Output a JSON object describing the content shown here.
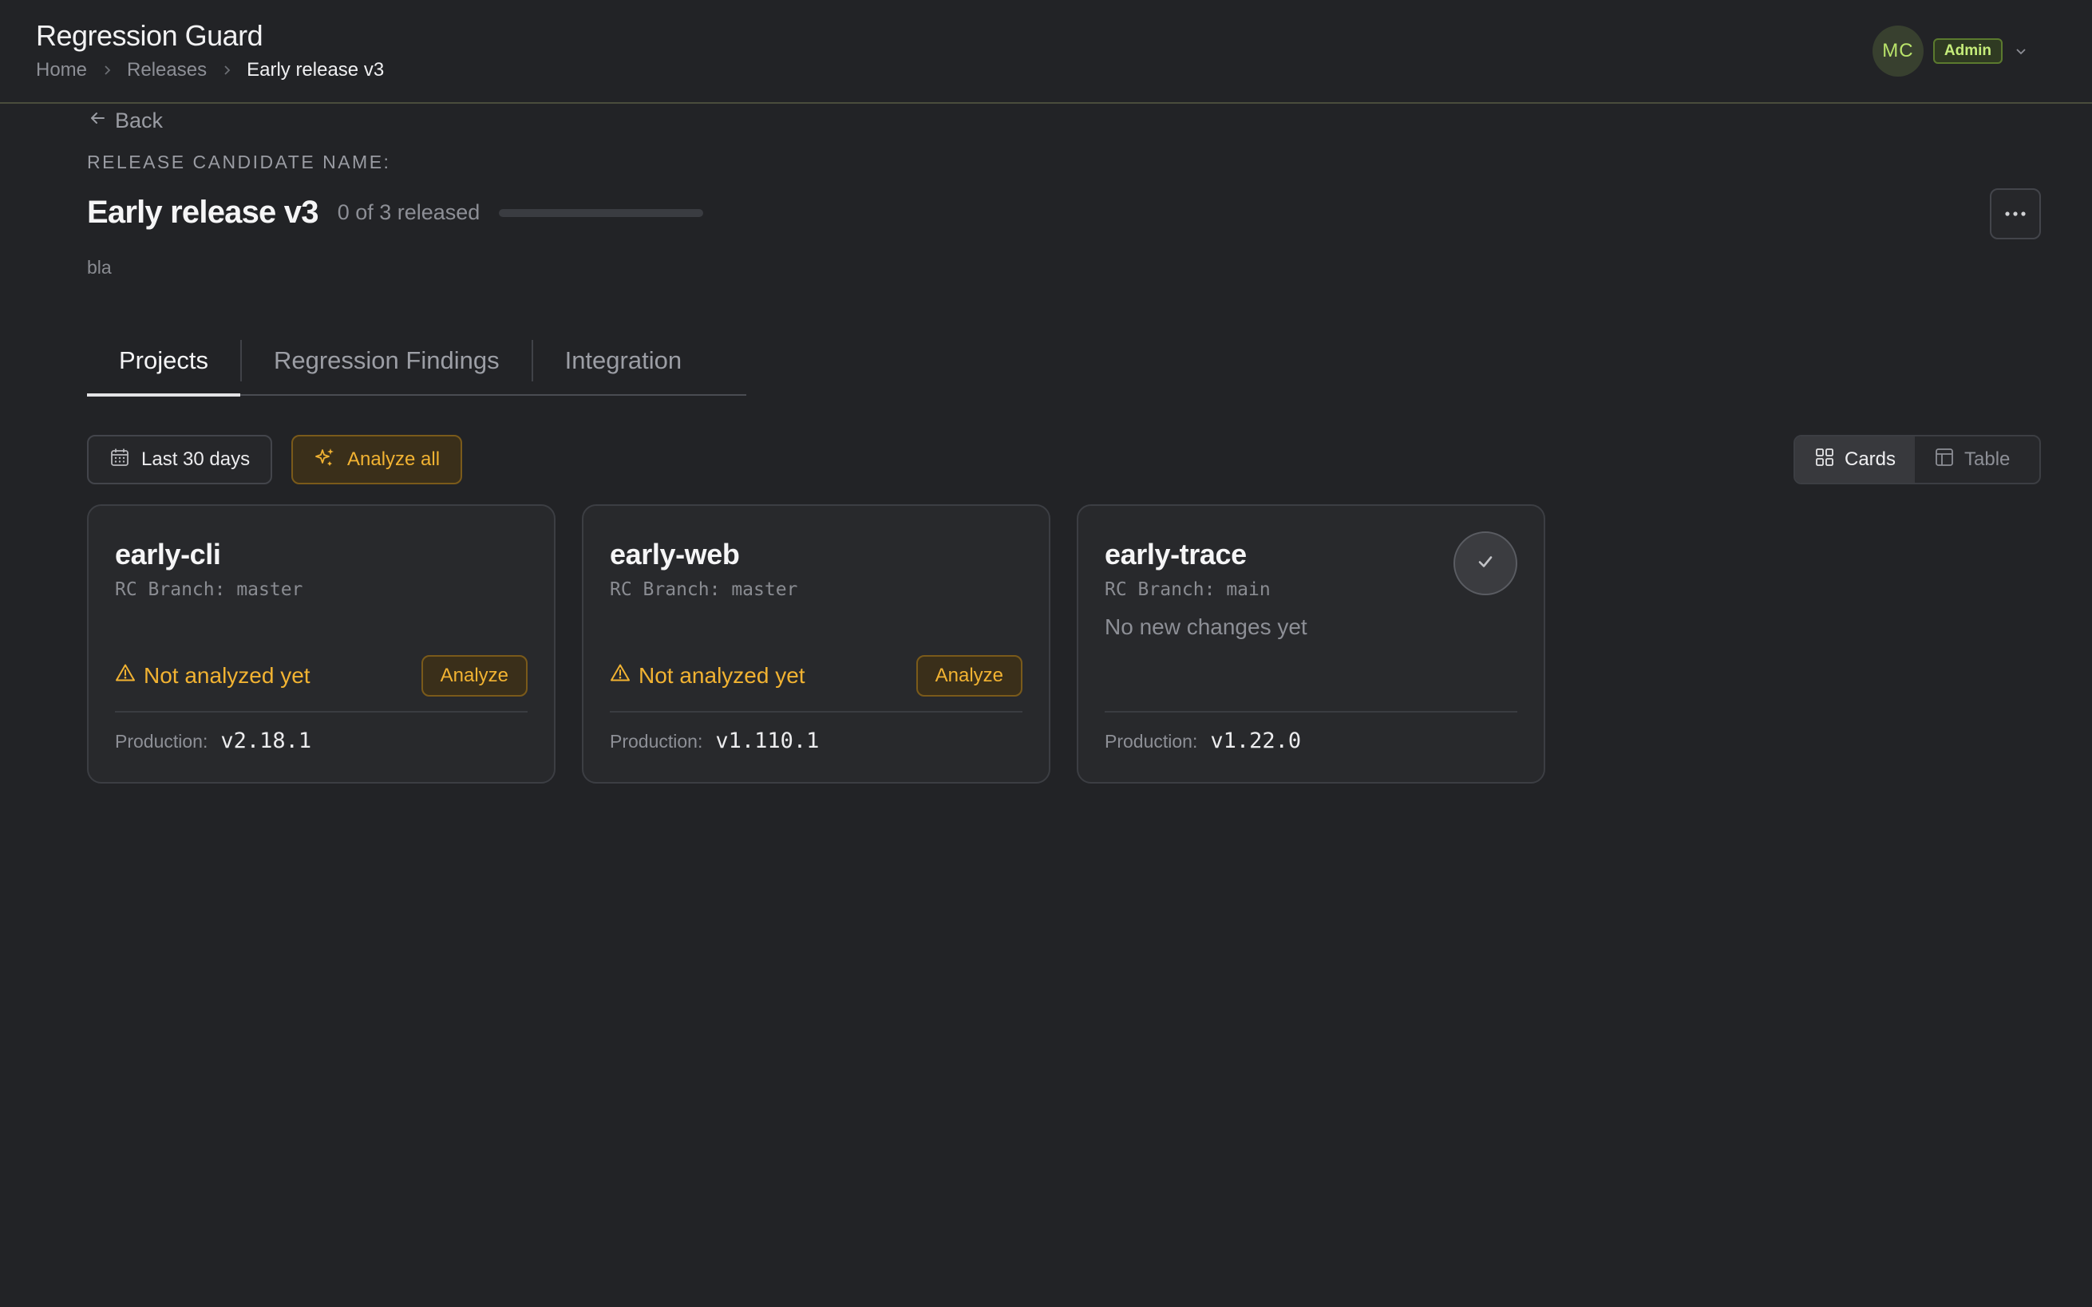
{
  "app": {
    "title": "Regression Guard"
  },
  "breadcrumb": [
    "Home",
    "Releases",
    "Early release v3"
  ],
  "user": {
    "initials": "MC",
    "role": "Admin"
  },
  "page": {
    "back_label": "Back",
    "section_label": "RELEASE CANDIDATE NAME:",
    "release_name": "Early release v3",
    "released_text": "0 of 3 released",
    "released_fraction": 0,
    "description": "bla"
  },
  "tabs": [
    {
      "label": "Projects",
      "active": true
    },
    {
      "label": "Regression Findings",
      "active": false
    },
    {
      "label": "Integration",
      "active": false
    }
  ],
  "toolbar": {
    "date_range": "Last 30 days",
    "analyze_all": "Analyze all"
  },
  "view_toggle": {
    "cards": "Cards",
    "table": "Table",
    "selected": "Cards"
  },
  "cards": [
    {
      "name": "early-cli",
      "branch": "RC Branch: master",
      "status": "Not analyzed yet",
      "action": "Analyze",
      "production_label": "Production:",
      "production_version": "v2.18.1"
    },
    {
      "name": "early-web",
      "branch": "RC Branch: master",
      "status": "Not analyzed yet",
      "action": "Analyze",
      "production_label": "Production:",
      "production_version": "v1.110.1"
    },
    {
      "name": "early-trace",
      "branch": "RC Branch: main",
      "status": "No new changes yet",
      "production_label": "Production:",
      "production_version": "v1.22.0",
      "released_icon": "check-icon"
    }
  ],
  "colors": {
    "background": "#222326",
    "warning": "#f2b332",
    "accent": "#b9e36a"
  }
}
